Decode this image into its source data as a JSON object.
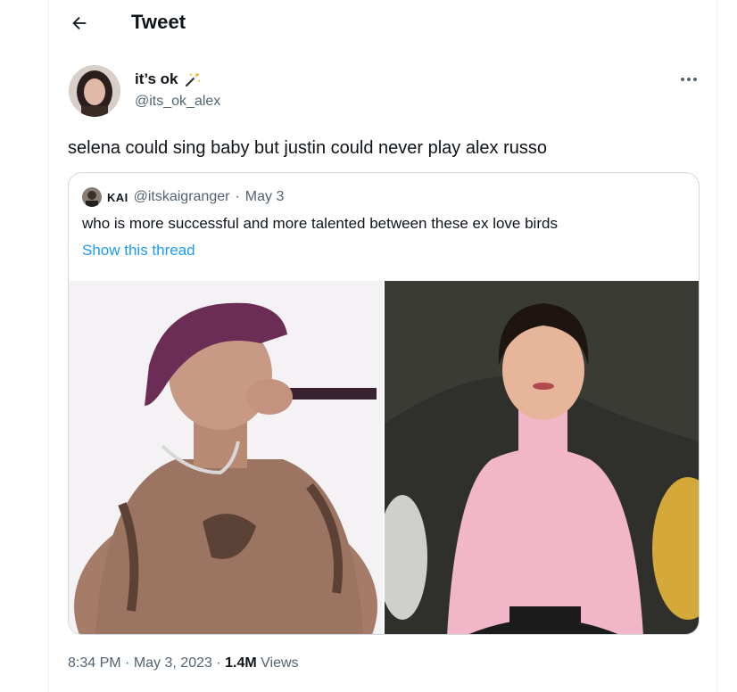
{
  "header": {
    "title": "Tweet",
    "back_icon": "arrow-left-icon"
  },
  "tweet": {
    "author": {
      "display_name": "it’s ok",
      "name_emoji": "magic-wand-icon",
      "handle": "@its_ok_alex"
    },
    "text": "selena could sing baby but justin could never play alex russo",
    "quoted": {
      "author_name": "KAI",
      "author_handle": "@itskaigranger",
      "separator": "·",
      "date": "May 3",
      "text": "who is more successful and more talented between these ex love birds",
      "show_thread": "Show this thread",
      "images": [
        "performer-singing-photo",
        "woman-pink-sweater-photo"
      ]
    },
    "meta": {
      "time": "8:34 PM",
      "separator": "·",
      "date": "May 3, 2023",
      "separator2": "·",
      "views_count": "1.4M",
      "views_label": "Views"
    }
  },
  "colors": {
    "accent": "#1d9bf0",
    "secondary_text": "#536471",
    "border": "#cfd9de"
  }
}
